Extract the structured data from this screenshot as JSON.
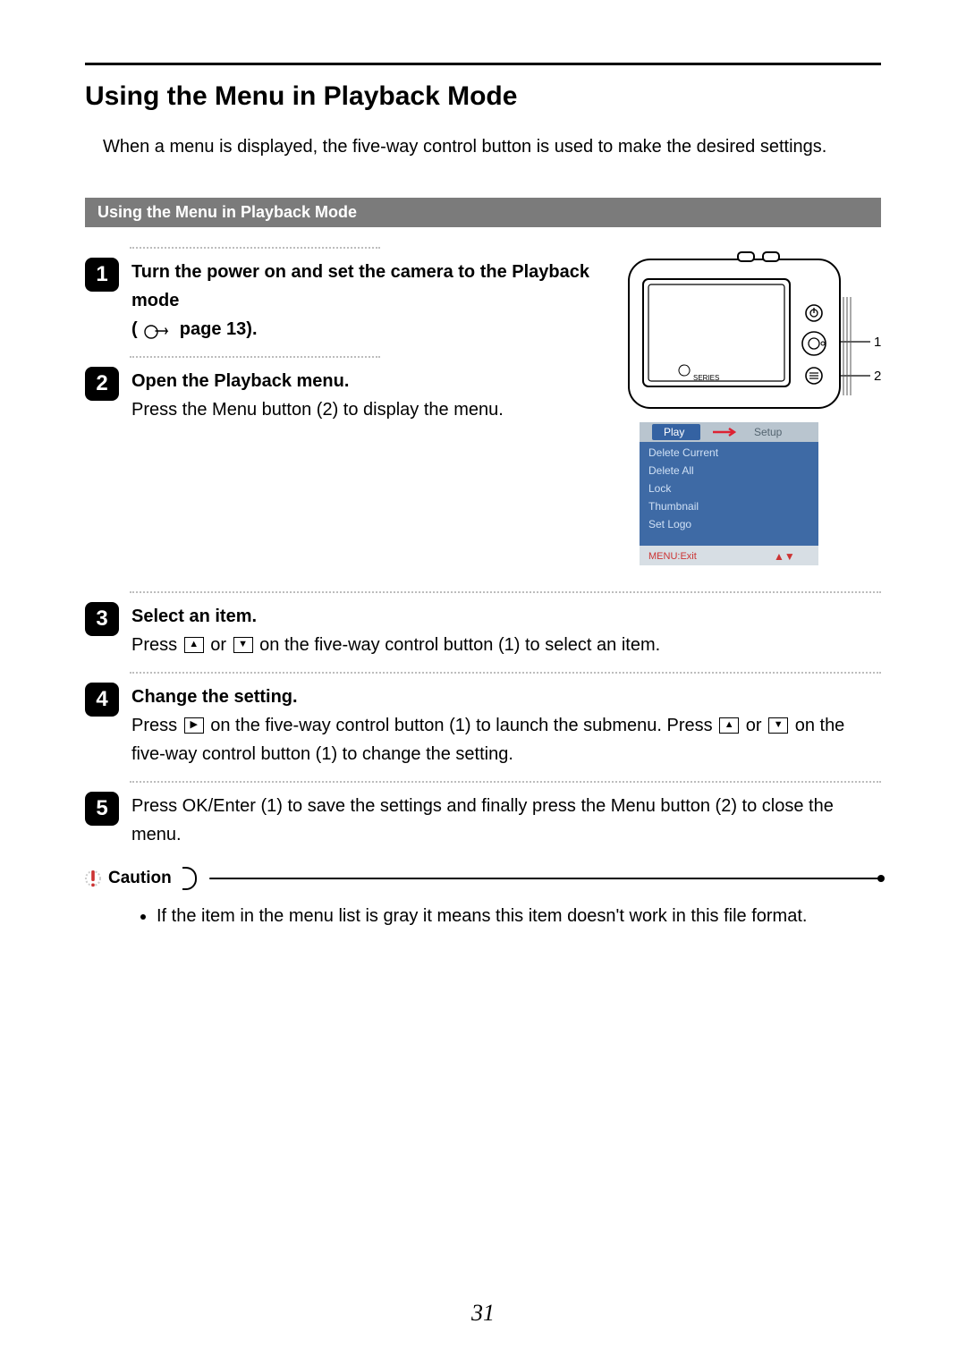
{
  "title": "Using the Menu in Playback Mode",
  "intro": "When a menu is displayed, the five-way control button is used to make the desired settings.",
  "section_header": "Using the Menu in Playback Mode",
  "steps": {
    "s1": {
      "num": "1",
      "line1": "Turn the power on and set the camera to the Playback mode",
      "page_ref": "page 13)."
    },
    "s2": {
      "num": "2",
      "head": "Open the Playback menu",
      "body": "Press the Menu button (2) to display the menu."
    },
    "s3": {
      "num": "3",
      "head": "Select an item",
      "body_a": "Press ",
      "body_b": " or ",
      "body_c": " on the five-way control button (1) to select an item."
    },
    "s4": {
      "num": "4",
      "head": "Change the setting",
      "body_a": "Press ",
      "body_b": " on the five-way control button (1) to launch the submenu. Press ",
      "body_c": " or ",
      "body_d": " on the five-way control button (1) to change the setting."
    },
    "s5": {
      "num": "5",
      "body": "Press OK/Enter (1) to save the settings and finally press the Menu button (2) to close the menu."
    }
  },
  "caution": {
    "label": "Caution",
    "item": "If the item in the menu list is gray it means this item doesn't work in this file format."
  },
  "page_number": "31",
  "camera_menu": {
    "tab_play": "Play",
    "tab_setup": "Setup",
    "items": [
      "Delete Current",
      "Delete All",
      "Lock",
      "Thumbnail",
      "Set Logo"
    ],
    "footer_left": "MENU:Exit",
    "footer_right": "▲▼"
  },
  "callouts": {
    "one": "1",
    "two": "2"
  }
}
